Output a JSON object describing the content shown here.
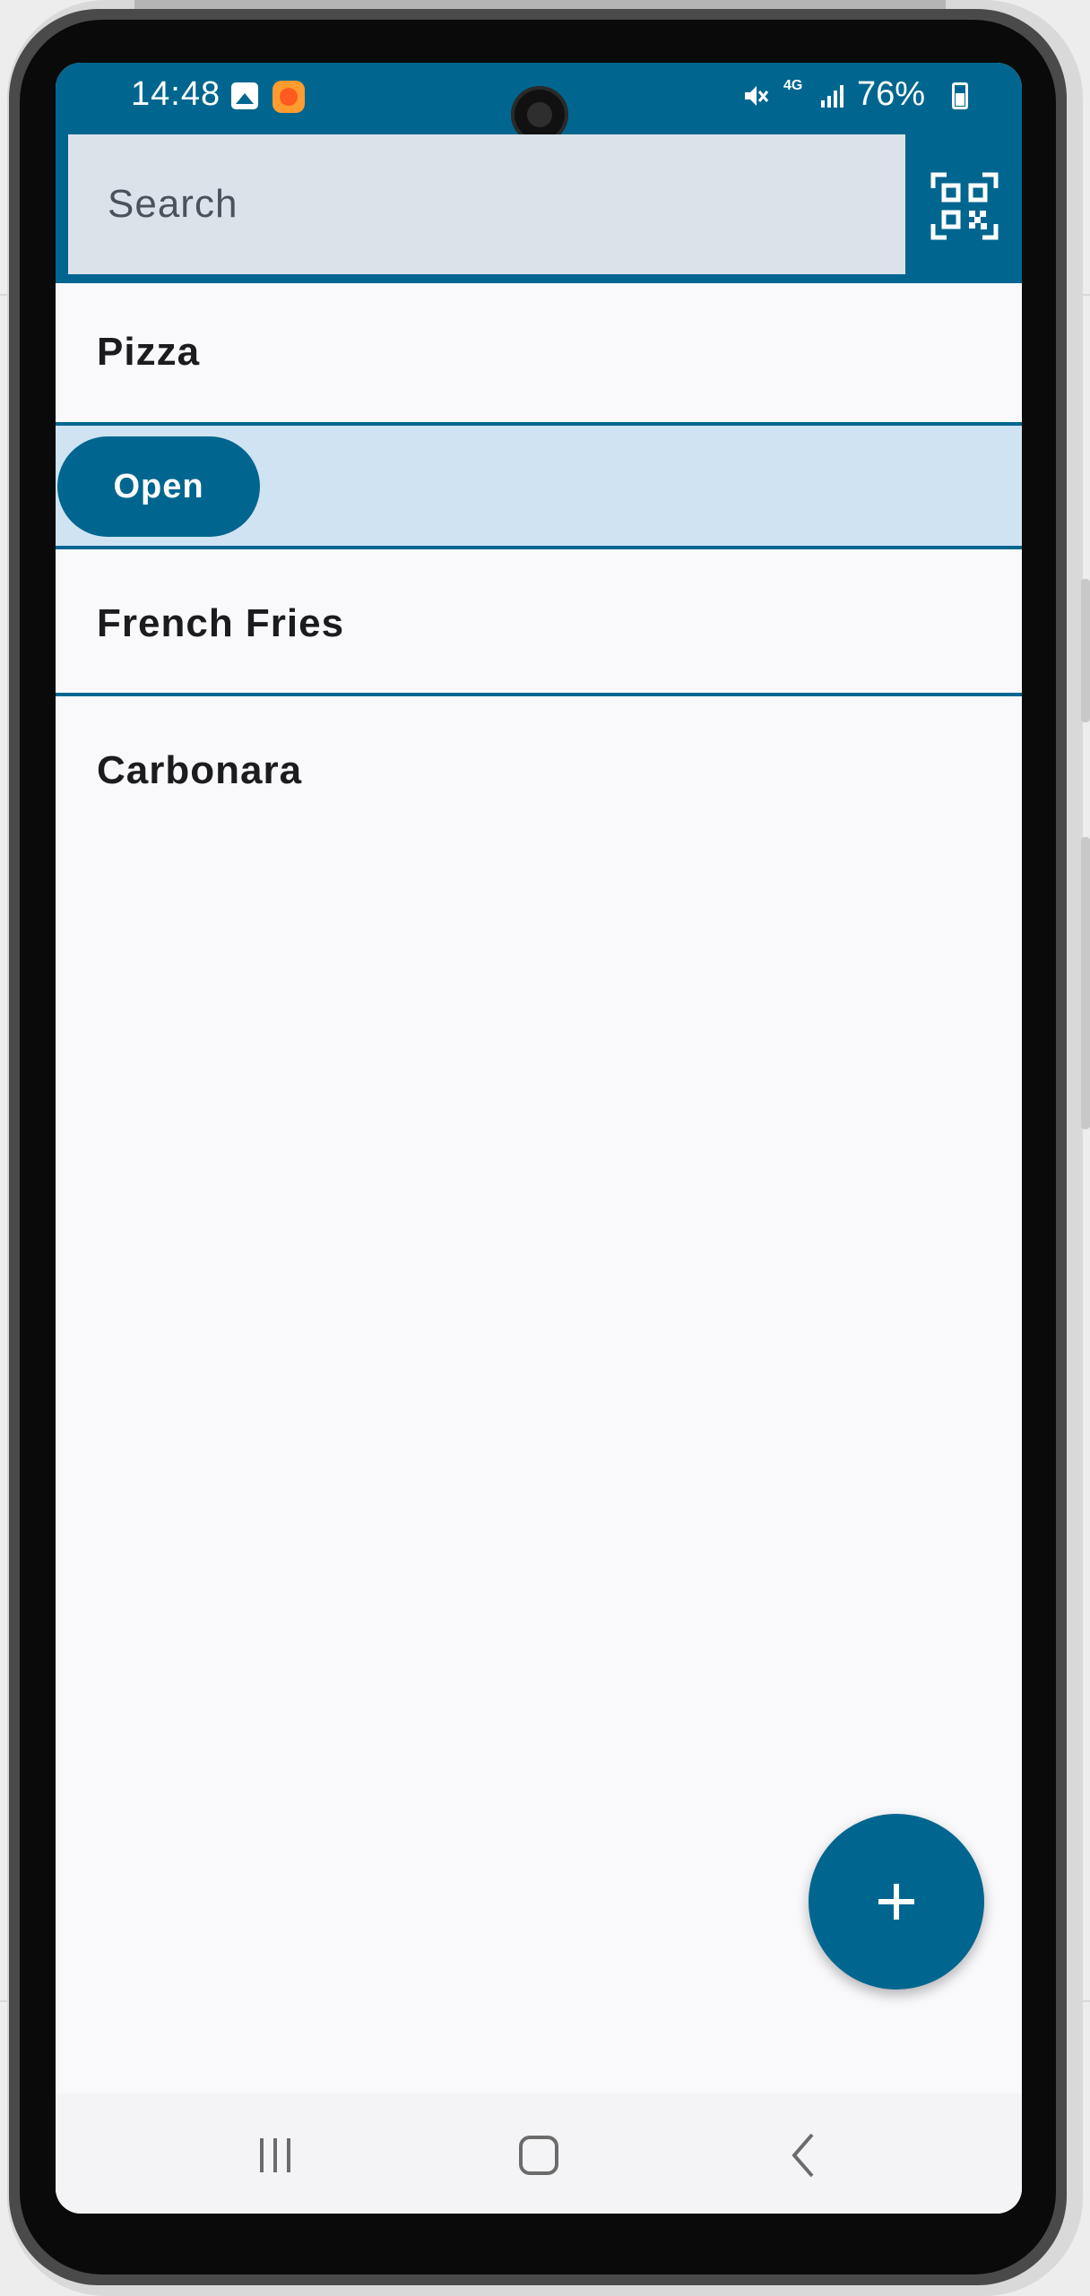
{
  "status_bar": {
    "time": "14:48",
    "network": "4G",
    "battery": "76%",
    "icons": [
      "gallery-icon",
      "notification-app-icon",
      "mute-icon",
      "signal-icon",
      "battery-icon"
    ]
  },
  "header": {
    "search_placeholder": "Search",
    "qr_icon": "qr-code-scan-icon"
  },
  "list": {
    "items": [
      {
        "label": "Pizza"
      },
      {
        "action_label": "Open"
      },
      {
        "label": "French Fries"
      },
      {
        "label": "Carbonara"
      }
    ]
  },
  "fab": {
    "icon": "plus-icon"
  },
  "navbar": {
    "icons": [
      "recents-icon",
      "home-icon",
      "back-icon"
    ]
  },
  "colors": {
    "primary": "#00668f",
    "selected_row": "#cfe3f2",
    "search_bg": "#dce2e9",
    "background": "#f9f9fc"
  }
}
